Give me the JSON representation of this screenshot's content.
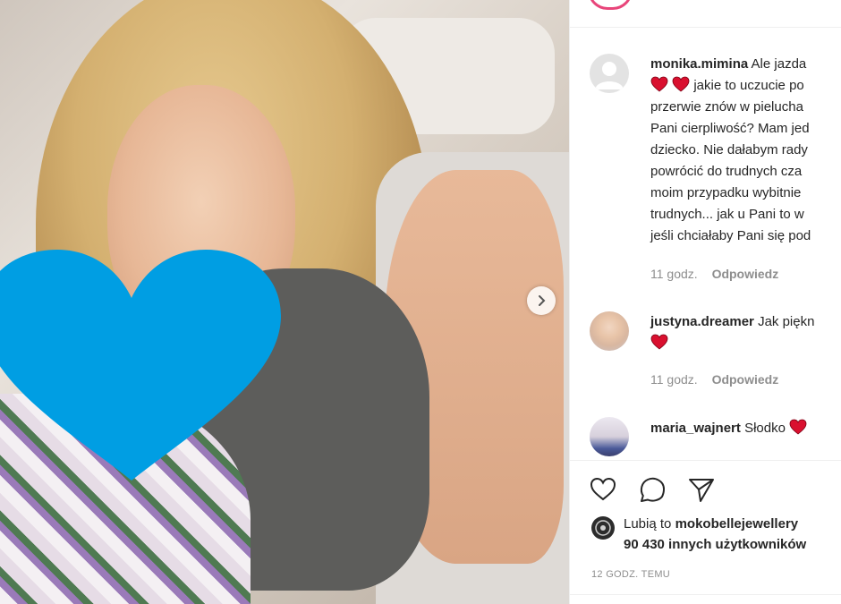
{
  "comments": [
    {
      "username": "monika.mimina",
      "lines": [
        "Ale jazda",
        "jakie to uczucie po",
        "przerwie znów w pielucha",
        "Pani cierpliwość? Mam jed",
        "dziecko. Nie dałabym rady",
        "powrócić do trudnych cza",
        "moim przypadku wybitnie",
        "trudnych... jak u Pani to w",
        "jeśli chciałaby Pani się pod"
      ],
      "time": "11 godz.",
      "reply": "Odpowiedz"
    },
    {
      "username": "justyna.dreamer",
      "text": "Jak piękn",
      "time": "11 godz.",
      "reply": "Odpowiedz"
    },
    {
      "username": "maria_wajnert",
      "text": "Słodko"
    }
  ],
  "likes": {
    "prefix": "Lubią to",
    "user": "mokobellejewellery",
    "others": "90 430 innych użytkowników"
  },
  "timestamp": "12 GODZ. TEMU",
  "colors": {
    "heart_overlay": "#009ee3",
    "heart_emoji": "#d9102f",
    "text": "#262626",
    "muted": "#8e8e8e"
  },
  "icons": [
    "heart-icon",
    "comment-icon",
    "share-icon",
    "chevron-right-icon"
  ]
}
